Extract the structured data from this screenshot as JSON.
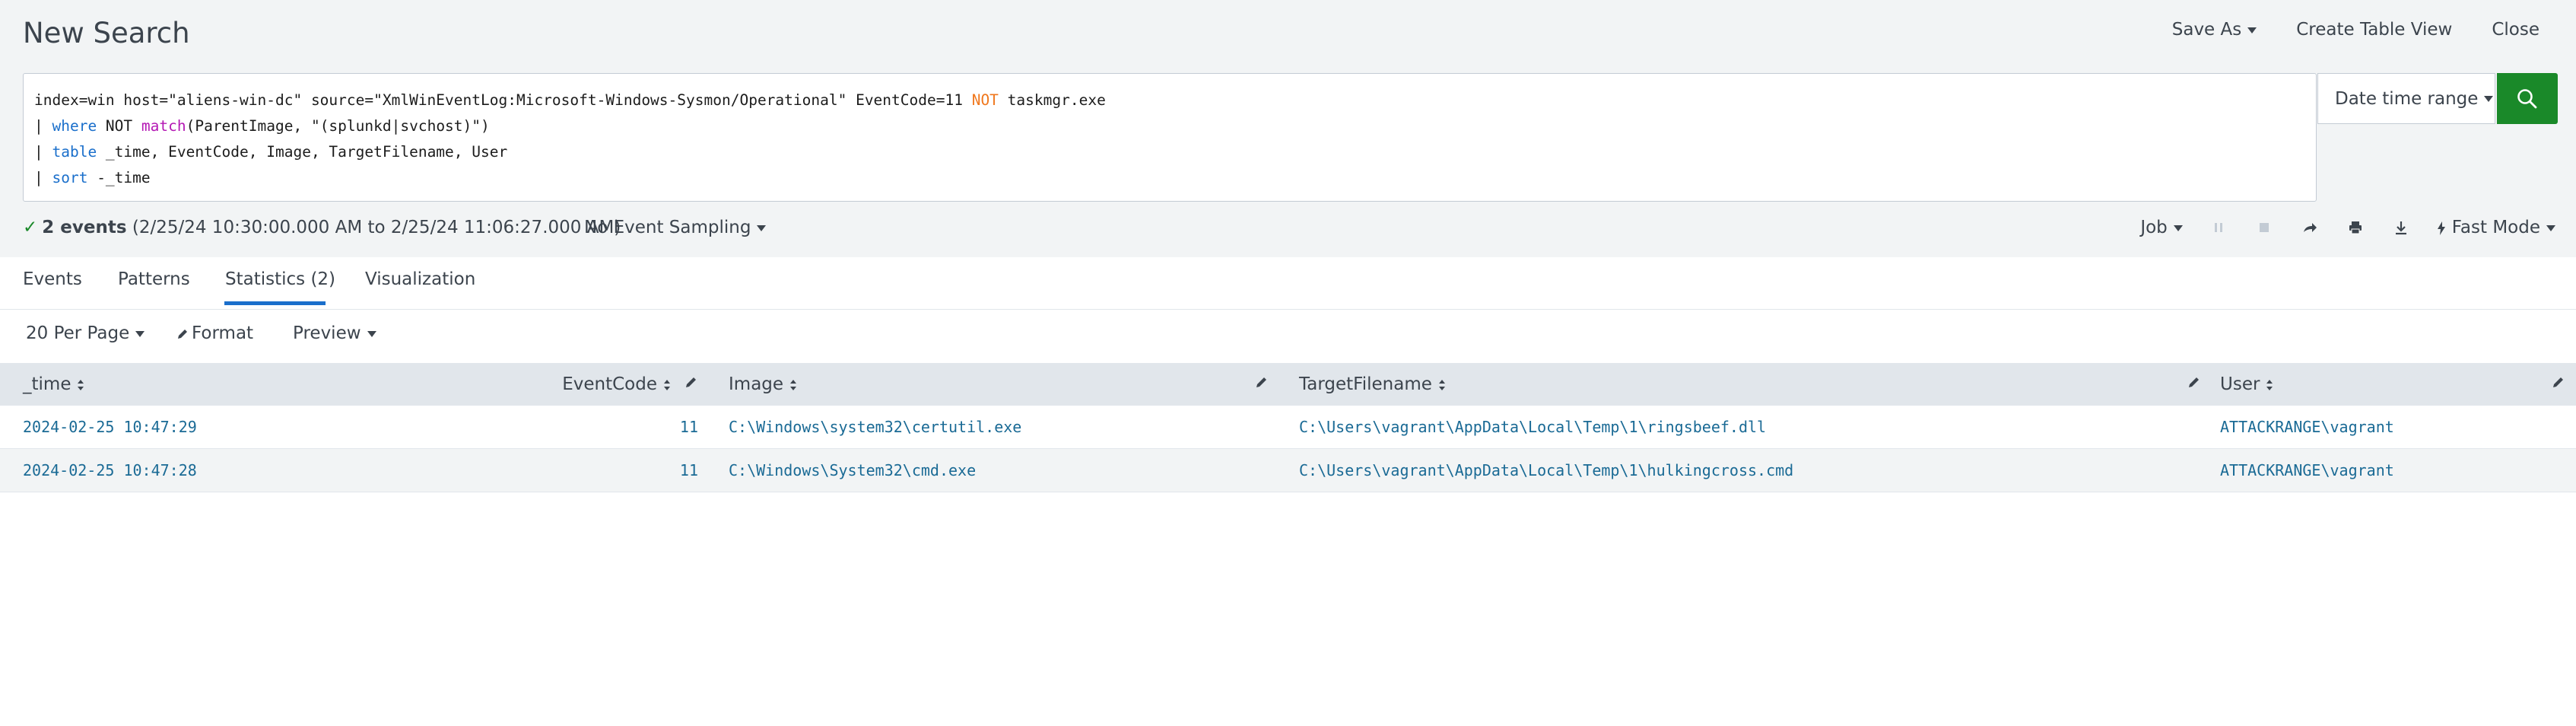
{
  "header": {
    "title": "New Search",
    "actions": [
      "Save As",
      "Create Table View",
      "Close"
    ]
  },
  "search": {
    "line1": {
      "a": "index=win host=\"aliens-win-dc\" source=\"XmlWinEventLog:Microsoft-Windows-Sysmon/Operational\" EventCode=11 ",
      "b": "NOT",
      "c": " taskmgr.exe"
    },
    "line2": {
      "pipe": "| ",
      "cmd": "where",
      "a": " NOT ",
      "fn": "match",
      "b": "(ParentImage, \"(splunkd|svchost)\")"
    },
    "line3": {
      "pipe": "| ",
      "cmd": "table",
      "a": " _time, EventCode, Image, TargetFilename, User"
    },
    "line4": {
      "pipe": "| ",
      "cmd": "sort",
      "a": " -_time"
    },
    "date_range": "Date time range"
  },
  "status": {
    "events": "2 events",
    "range": "(2/25/24 10:30:00.000 AM to 2/25/24 11:06:27.000 AM)",
    "sampling": "No Event Sampling",
    "job": "Job",
    "mode": "Fast Mode"
  },
  "tabs": [
    "Events",
    "Patterns",
    "Statistics (2)",
    "Visualization"
  ],
  "toolbar": {
    "per_page": "20 Per Page",
    "format": "Format",
    "preview": "Preview"
  },
  "table": {
    "columns": [
      "_time",
      "EventCode",
      "Image",
      "TargetFilename",
      "User"
    ],
    "rows": [
      [
        "2024-02-25 10:47:29",
        "11",
        "C:\\Windows\\system32\\certutil.exe",
        "C:\\Users\\vagrant\\AppData\\Local\\Temp\\1\\ringsbeef.dll",
        "ATTACKRANGE\\vagrant"
      ],
      [
        "2024-02-25 10:47:28",
        "11",
        "C:\\Windows\\System32\\cmd.exe",
        "C:\\Users\\vagrant\\AppData\\Local\\Temp\\1\\hulkingcross.cmd",
        "ATTACKRANGE\\vagrant"
      ]
    ]
  },
  "colors": {
    "accent": "#1a6fcb",
    "search_button": "#1a8929",
    "cell_text": "#1a6a95",
    "keyword_orange": "#f0781e",
    "keyword_magenta": "#b418b4"
  }
}
